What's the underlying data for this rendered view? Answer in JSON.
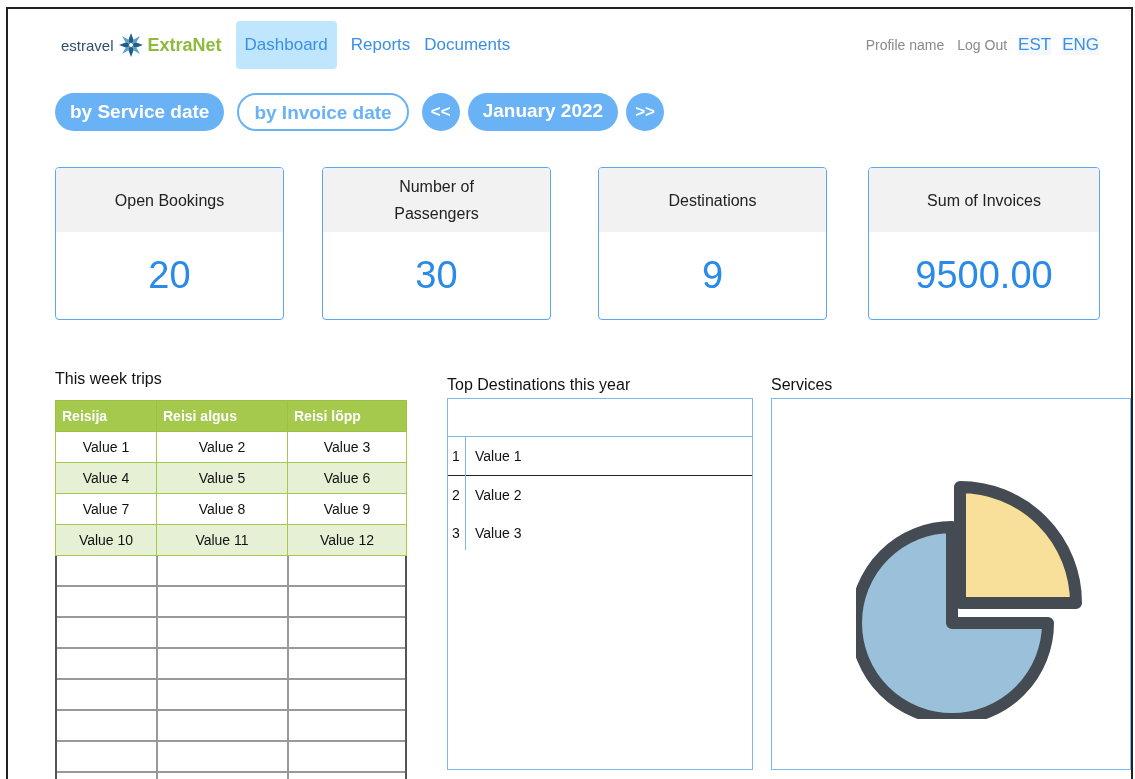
{
  "brand": {
    "company": "estravel",
    "product": "ExtraNet"
  },
  "nav": [
    {
      "label": "Dashboard",
      "selected": true
    },
    {
      "label": "Reports",
      "selected": false
    },
    {
      "label": "Documents",
      "selected": false
    }
  ],
  "account": {
    "profile": "Profile name",
    "logout": "Log Out",
    "languages": [
      "EST",
      "ENG"
    ]
  },
  "date_modes": [
    {
      "label": "by Service date",
      "selected": true
    },
    {
      "label": "by Invoice date",
      "selected": false
    }
  ],
  "period": {
    "prev": "<<",
    "label": "January 2022",
    "next": ">>"
  },
  "stats": [
    {
      "title": "Open Bookings",
      "value": "20"
    },
    {
      "title": "Number of Passengers",
      "value": "30"
    },
    {
      "title": "Destinations",
      "value": "9"
    },
    {
      "title": "Sum of Invoices",
      "value": "9500.00"
    }
  ],
  "trips": {
    "title": "This week trips",
    "columns": [
      "Reisija",
      "Reisi algus",
      "Reisi lõpp"
    ],
    "rows": [
      [
        "Value 1",
        "Value 2",
        "Value 3"
      ],
      [
        "Value 4",
        "Value 5",
        "Value 6"
      ],
      [
        "Value 7",
        "Value 8",
        "Value 9"
      ],
      [
        "Value 10",
        "Value 11",
        "Value 12"
      ]
    ]
  },
  "destinations": {
    "title": "Top Destinations this year",
    "rows": [
      {
        "rank": "1",
        "name": "Value 1"
      },
      {
        "rank": "2",
        "name": "Value 2"
      },
      {
        "rank": "3",
        "name": "Value 3"
      }
    ]
  },
  "services": {
    "title": "Services"
  }
}
